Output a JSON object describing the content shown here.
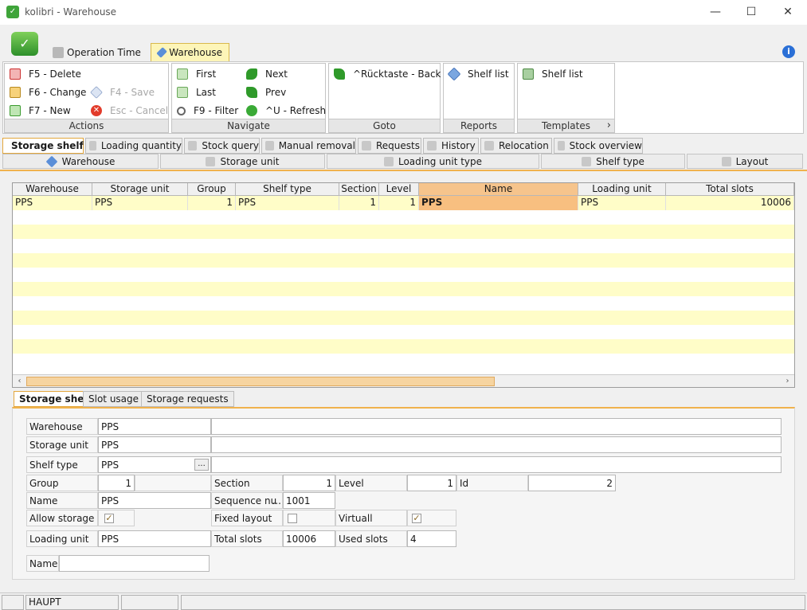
{
  "window": {
    "title": "kolibri - Warehouse",
    "minimize": "—",
    "maximize": "☐",
    "close": "✕"
  },
  "ribbon_tabs": [
    {
      "label": "Operation Time",
      "icon": "clock-doc-icon"
    },
    {
      "label": "Warehouse",
      "icon": "warehouse-diamond-icon",
      "active": true
    }
  ],
  "ribbon": {
    "actions": {
      "label": "Actions",
      "delete": "F5 - Delete",
      "change": "F6 - Change",
      "new": "F7 - New",
      "save": "F4 - Save",
      "cancel": "Esc - Cancel"
    },
    "navigate": {
      "label": "Navigate",
      "first": "First",
      "last": "Last",
      "filter": "F9 - Filter",
      "next": "Next",
      "prev": "Prev",
      "refresh": "^U - Refresh"
    },
    "goto": {
      "label": "Goto",
      "back": "^Rücktaste - Back"
    },
    "reports": {
      "label": "Reports",
      "shelf_list": "Shelf list"
    },
    "templates": {
      "label": "Templates",
      "shelf_list": "Shelf list",
      "more": "›"
    }
  },
  "module_tabs": [
    "Storage shelf",
    "Loading quantity",
    "Stock query",
    "Manual removal",
    "Requests",
    "History",
    "Relocation",
    "Stock overview"
  ],
  "sub_tabs": [
    "Warehouse",
    "Storage unit",
    "Loading unit type",
    "Shelf type",
    "Layout"
  ],
  "grid": {
    "columns": [
      "Warehouse",
      "Storage unit",
      "Group",
      "Shelf type",
      "Section",
      "Level",
      "Name",
      "Loading unit",
      "Total slots"
    ],
    "rows": [
      [
        "PPS",
        "PPS",
        "1",
        "PPS",
        "1",
        "1",
        "PPS",
        "PPS",
        "10006"
      ]
    ],
    "scroll_left": "‹",
    "scroll_right": "›"
  },
  "detail_tabs": [
    "Storage shelf",
    "Slot usage",
    "Storage requests"
  ],
  "detail": {
    "warehouse_label": "Warehouse",
    "warehouse": "PPS",
    "storage_unit_label": "Storage unit",
    "storage_unit": "PPS",
    "shelf_type_label": "Shelf type",
    "shelf_type": "PPS",
    "shelf_type_button": "...",
    "group_label": "Group",
    "group": "1",
    "section_label": "Section",
    "section": "1",
    "level_label": "Level",
    "level": "1",
    "id_label": "Id",
    "id": "2",
    "name_label": "Name",
    "name": "PPS",
    "sequence_label": "Sequence nu",
    "sequence_button": "...",
    "sequence": "1001",
    "allow_storage_label": "Allow storage",
    "allow_storage": "✓",
    "fixed_layout_label": "Fixed layout",
    "virtual_label": "Virtuall",
    "virtual": "✓",
    "loading_unit_label": "Loading unit",
    "loading_unit": "PPS",
    "total_slots_label": "Total slots",
    "total_slots": "10006",
    "used_slots_label": "Used slots",
    "used_slots": "4",
    "name2_label": "Name",
    "name2": ""
  },
  "status": {
    "panel1": "",
    "panel2": "HAUPT",
    "panel3": "",
    "panel4": ""
  }
}
